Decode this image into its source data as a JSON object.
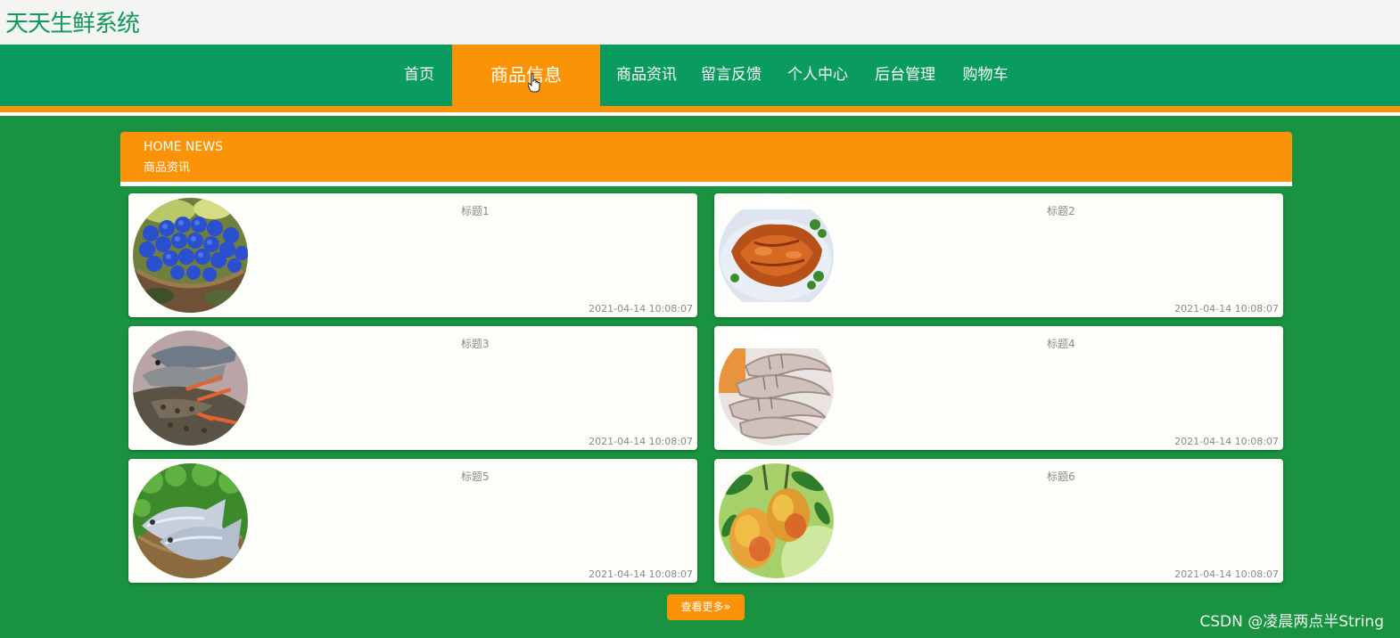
{
  "header": {
    "site_title": "天天生鲜系统"
  },
  "nav": {
    "items": [
      {
        "label": "首页",
        "active": false
      },
      {
        "label": "商品信息",
        "active": true
      },
      {
        "label": "商品资讯",
        "active": false
      },
      {
        "label": "留言反馈",
        "active": false
      },
      {
        "label": "个人中心",
        "active": false
      },
      {
        "label": "后台管理",
        "active": false
      },
      {
        "label": "购物车",
        "active": false
      }
    ]
  },
  "section": {
    "title_en": "HOME NEWS",
    "title_cn": "商品资讯"
  },
  "news": [
    {
      "title": "标题1",
      "date": "2021-04-14 10:08:07",
      "image": "blueberries"
    },
    {
      "title": "标题2",
      "date": "2021-04-14 10:08:07",
      "image": "roast-duck"
    },
    {
      "title": "标题3",
      "date": "2021-04-14 10:08:07",
      "image": "fish-and-lobster"
    },
    {
      "title": "标题4",
      "date": "2021-04-14 10:08:07",
      "image": "shrimp"
    },
    {
      "title": "标题5",
      "date": "2021-04-14 10:08:07",
      "image": "pomfret-fish"
    },
    {
      "title": "标题6",
      "date": "2021-04-14 10:08:07",
      "image": "mangoes"
    }
  ],
  "more_button": {
    "label": "查看更多",
    "icon": "double-chevron-right-icon"
  },
  "watermark": "CSDN @凌晨两点半String",
  "colors": {
    "brand_green": "#0a9b60",
    "page_green": "#1a9340",
    "accent_orange": "#fb9308",
    "title_green": "#0f9a5b"
  }
}
